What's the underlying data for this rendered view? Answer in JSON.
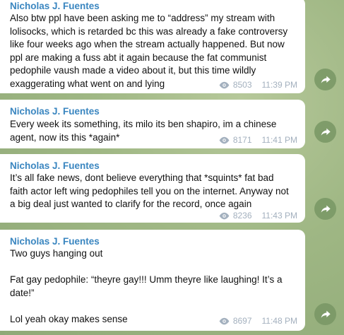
{
  "colors": {
    "author": "#3a86c0",
    "bubble": "#ffffff",
    "meta": "#a3b0be",
    "share_button": "#7c9a66"
  },
  "messages": [
    {
      "author": "Nicholas J. Fuentes",
      "text": "Also btw ppl have been asking me to “address” my stream with\nlolisocks, which is retarded bc this was already a fake controversy\nlike four weeks ago when the stream actually happened. But now\nppl are making a fuss abt it again because the fat communist\npedophile vaush made a video about it, but this time wildly\nexaggerating what went on and lying",
      "views": "8503",
      "time": "11:39 PM"
    },
    {
      "author": "Nicholas J. Fuentes",
      "text": "Every week its something, its milo its ben shapiro, im a chinese\nagent, now its this *again*",
      "views": "8171",
      "time": "11:41 PM"
    },
    {
      "author": "Nicholas J. Fuentes",
      "text": "It’s all fake news, dont believe everything that *squints* fat bad\nfaith actor left wing pedophiles tell you on the internet. Anyway not\na big deal just wanted to clarify for the record, once again",
      "views": "8236",
      "time": "11:43 PM"
    },
    {
      "author": "Nicholas J. Fuentes",
      "text": "Two guys hanging out\n\nFat gay pedophile: “theyre gay!!! Umm theyre like laughing! It’s a\ndate!”\n\nLol yeah okay makes sense",
      "views": "8697",
      "time": "11:48 PM"
    }
  ],
  "icons": {
    "views": "eye-icon",
    "share": "share-arrow-icon"
  }
}
